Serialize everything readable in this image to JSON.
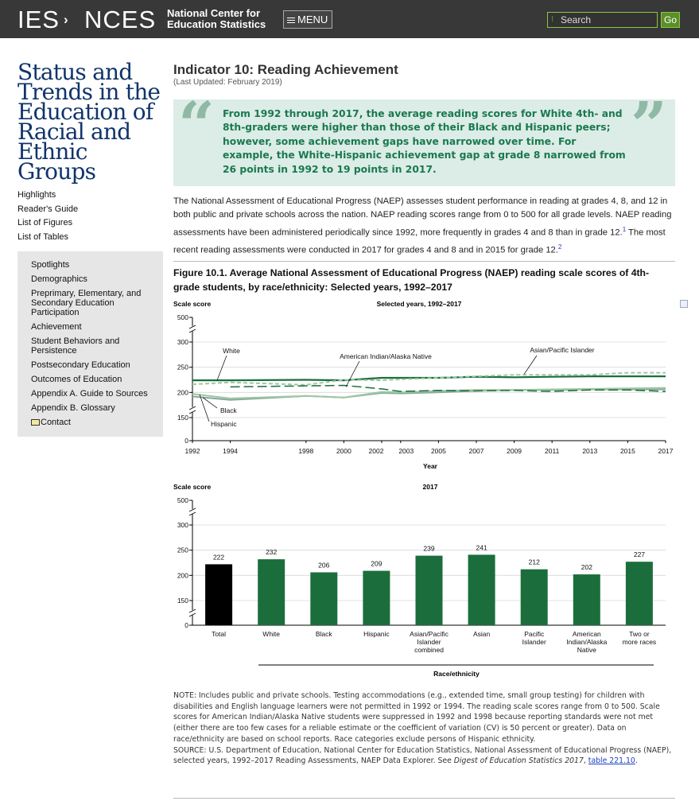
{
  "header": {
    "logo_left": "IES",
    "logo_arrow": ">",
    "logo_right": "NCES",
    "subtitle_line1": "National Center for",
    "subtitle_line2": "Education Statistics",
    "menu_label": "MENU",
    "search_placeholder": "Search",
    "go_label": "Go"
  },
  "sidebar": {
    "title": "Status and Trends in the Education of Racial and Ethnic Groups",
    "links": [
      "Highlights",
      "Reader's Guide",
      "List of Figures",
      "List of Tables"
    ],
    "nav": [
      "Spotlights",
      "Demographics",
      "Preprimary, Elementary, and Secondary Education Participation",
      "Achievement",
      "Student Behaviors and Persistence",
      "Postsecondary Education",
      "Outcomes of Education",
      "Appendix A. Guide to Sources",
      "Appendix B. Glossary",
      "Contact"
    ]
  },
  "main": {
    "title": "Indicator 10: Reading Achievement",
    "updated": "(Last Updated: February 2019)",
    "quote": "From 1992 through 2017, the average reading scores for White 4th- and 8th-graders were higher than those of their Black and Hispanic peers; however, some achievement gaps have narrowed over time. For example, the White-Hispanic achievement gap at grade 8 narrowed from 26 points in 1992 to 19 points in 2017.",
    "intro_part1": "The National Assessment of Educational Progress (NAEP) assesses student performance in reading at grades 4, 8, and 12 in both public and private schools across the nation. NAEP reading scores range from 0 to 500 for all grade levels. NAEP reading assessments have been administered periodically since 1992, more frequently in grades 4 and 8 than in grade 12.",
    "footnote1": "1",
    "intro_part2": " The most recent reading assessments were conducted in 2017 for grades 4 and 8 and in 2015 for grade 12.",
    "footnote2": "2",
    "figure_title": "Figure 10.1. Average National Assessment of Educational Progress (NAEP) reading scale scores of 4th-grade students, by race/ethnicity: Selected years, 1992–2017",
    "note": "NOTE: Includes public and private schools. Testing accommodations (e.g., extended time, small group testing) for children with disabilities and English language learners were not permitted in 1992 or 1994. The reading scale scores range from 0 to 500. Scale scores for American Indian/Alaska Native students were suppressed in 1992 and 1998 because reporting standards were not met (either there are too few cases for a reliable estimate or the coefficient of variation (CV) is 50 percent or greater). Data on race/ethnicity are based on school reports. Race categories exclude persons of Hispanic ethnicity.",
    "source_part1": "SOURCE: U.S. Department of Education, National Center for Education Statistics, National Assessment of Educational Progress (NAEP), selected years, 1992–2017 Reading Assessments, NAEP Data Explorer. See ",
    "source_ital": "Digest of Education Statistics 2017",
    "source_part2": ", ",
    "source_link": "table 221.10",
    "source_end": "."
  },
  "colors": {
    "dark_green": "#1b6e3b",
    "light_green": "#9dc7a5",
    "gray_green": "#8aa89a",
    "black": "#000000"
  },
  "chart_data": [
    {
      "type": "line",
      "subtitle": "Selected years, 1992–2017",
      "ylabel": "Scale score",
      "xlabel": "Year",
      "ylim": [
        0,
        500
      ],
      "yticks": [
        "0",
        "150",
        "200",
        "250",
        "300",
        "500"
      ],
      "x": [
        1992,
        1994,
        1998,
        2000,
        2002,
        2003,
        2005,
        2007,
        2009,
        2011,
        2013,
        2015,
        2017
      ],
      "series": [
        {
          "name": "White",
          "values": [
            224,
            224,
            225,
            224,
            229,
            229,
            229,
            231,
            230,
            231,
            232,
            232,
            232
          ]
        },
        {
          "name": "Black",
          "values": [
            192,
            185,
            193,
            190,
            199,
            198,
            200,
            203,
            205,
            205,
            206,
            206,
            206
          ]
        },
        {
          "name": "Hispanic",
          "values": [
            197,
            188,
            193,
            190,
            201,
            200,
            203,
            205,
            205,
            206,
            207,
            208,
            209
          ]
        },
        {
          "name": "Asian/Pacific Islander",
          "values": [
            216,
            220,
            215,
            225,
            224,
            226,
            229,
            232,
            235,
            235,
            235,
            239,
            239
          ]
        },
        {
          "name": "American Indian/Alaska Native",
          "values": [
            null,
            211,
            null,
            214,
            207,
            202,
            204,
            203,
            204,
            202,
            205,
            205,
            202
          ]
        }
      ]
    },
    {
      "type": "bar",
      "subtitle": "2017",
      "ylabel": "Scale score",
      "xlabel": "Race/ethnicity",
      "ylim": [
        0,
        500
      ],
      "yticks": [
        "0",
        "150",
        "200",
        "250",
        "300",
        "500"
      ],
      "categories": [
        "Total",
        "White",
        "Black",
        "Hispanic",
        "Asian/Pacific Islander combined",
        "Asian",
        "Pacific Islander",
        "American Indian/Alaska Native",
        "Two or more races"
      ],
      "values": [
        222,
        232,
        206,
        209,
        239,
        241,
        212,
        202,
        227
      ]
    }
  ]
}
